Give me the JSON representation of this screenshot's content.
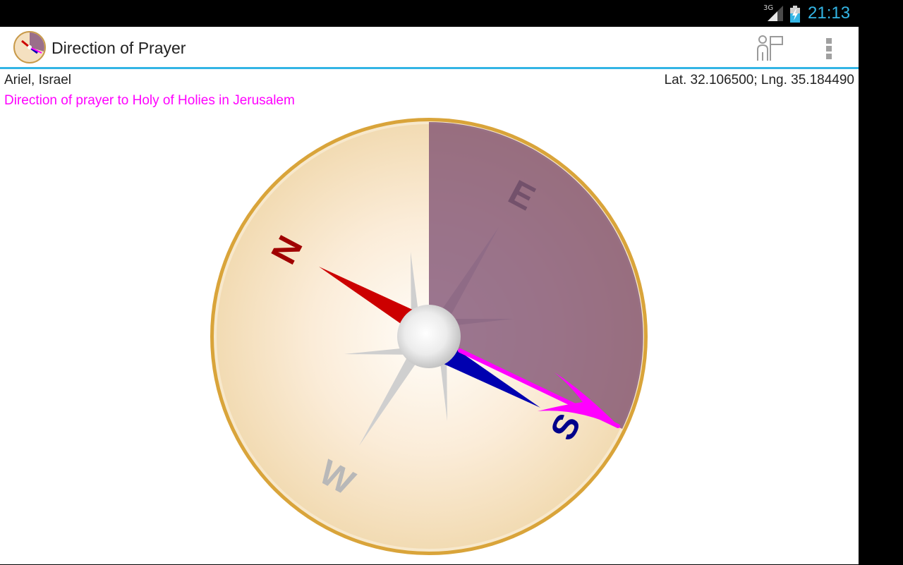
{
  "status_bar": {
    "network": "3G",
    "time": "21:13"
  },
  "action_bar": {
    "title": "Direction of Prayer",
    "app_icon": "compass-app-icon",
    "actions": [
      {
        "name": "person-flag-icon"
      },
      {
        "name": "overflow-menu-icon"
      }
    ]
  },
  "location": {
    "place": "Ariel, Israel",
    "coordinates": "Lat. 32.106500; Lng. 35.184490"
  },
  "direction_label": "Direction of prayer to Holy of Holies in Jerusalem",
  "compass": {
    "labels": {
      "north": "N",
      "east": "E",
      "south": "S",
      "west": "W"
    },
    "colors": {
      "needle_north": "#cc0000",
      "needle_south": "#0000b0",
      "prayer_arrow": "#ff00ff",
      "sector": "#7a4a6e",
      "rim": "#d9a43a"
    }
  }
}
